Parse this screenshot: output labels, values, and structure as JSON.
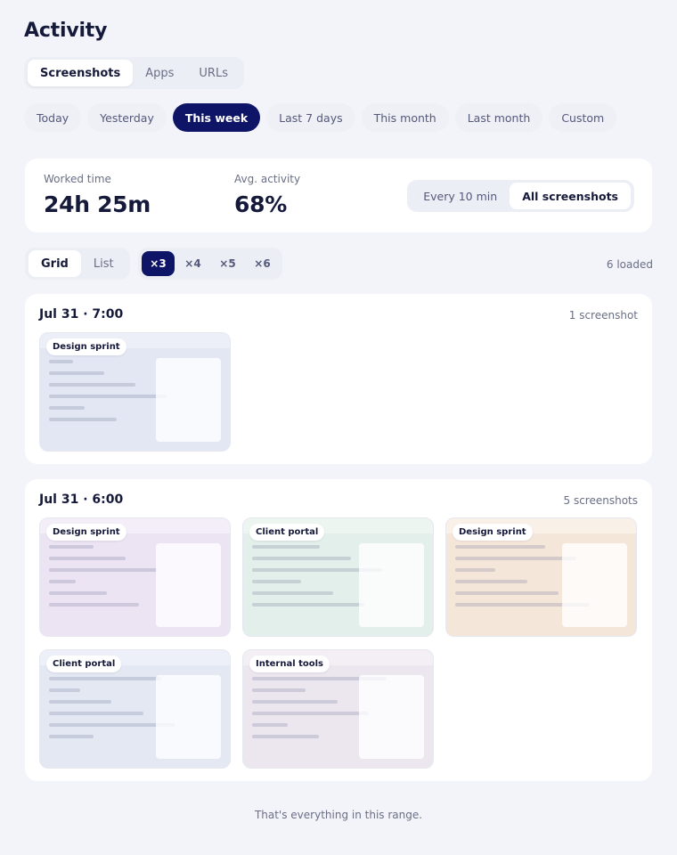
{
  "page": {
    "title": "Activity"
  },
  "tabs": [
    {
      "label": "Screenshots",
      "active": true
    },
    {
      "label": "Apps",
      "active": false
    },
    {
      "label": "URLs",
      "active": false
    }
  ],
  "ranges": [
    {
      "label": "Today",
      "active": false
    },
    {
      "label": "Yesterday",
      "active": false
    },
    {
      "label": "This week",
      "active": true
    },
    {
      "label": "Last 7 days",
      "active": false
    },
    {
      "label": "This month",
      "active": false
    },
    {
      "label": "Last month",
      "active": false
    },
    {
      "label": "Custom",
      "active": false
    }
  ],
  "stats": {
    "worked_label": "Worked time",
    "worked_value": "24h 25m",
    "activity_label": "Avg. activity",
    "activity_value": "68%",
    "frequency": [
      {
        "label": "Every 10 min",
        "active": false
      },
      {
        "label": "All screenshots",
        "active": true
      }
    ]
  },
  "view": {
    "modes": [
      {
        "label": "Grid",
        "active": true
      },
      {
        "label": "List",
        "active": false
      }
    ],
    "zoom": [
      {
        "label": "×3",
        "active": true
      },
      {
        "label": "×4",
        "active": false
      },
      {
        "label": "×5",
        "active": false
      },
      {
        "label": "×6",
        "active": false
      }
    ],
    "loaded": "6 loaded"
  },
  "groups": [
    {
      "title": "Jul 31 · 7:00",
      "count": "1 screenshot",
      "screenshots": [
        {
          "tag": "Design sprint",
          "tint": "#e3e7f3",
          "bar": "#eceff7"
        }
      ]
    },
    {
      "title": "Jul 31 · 6:00",
      "count": "5 screenshots",
      "screenshots": [
        {
          "tag": "Design sprint",
          "tint": "#ece3f3",
          "bar": "#f3eef8"
        },
        {
          "tag": "Client portal",
          "tint": "#e2efea",
          "bar": "#edf5f1"
        },
        {
          "tag": "Design sprint",
          "tint": "#f5e6da",
          "bar": "#f9f0e8"
        },
        {
          "tag": "Client portal",
          "tint": "#e4e8f3",
          "bar": "#edf0f8"
        },
        {
          "tag": "Internal tools",
          "tint": "#ece6ef",
          "bar": "#f3eff5"
        }
      ]
    }
  ],
  "footer": "That's everything in this range."
}
